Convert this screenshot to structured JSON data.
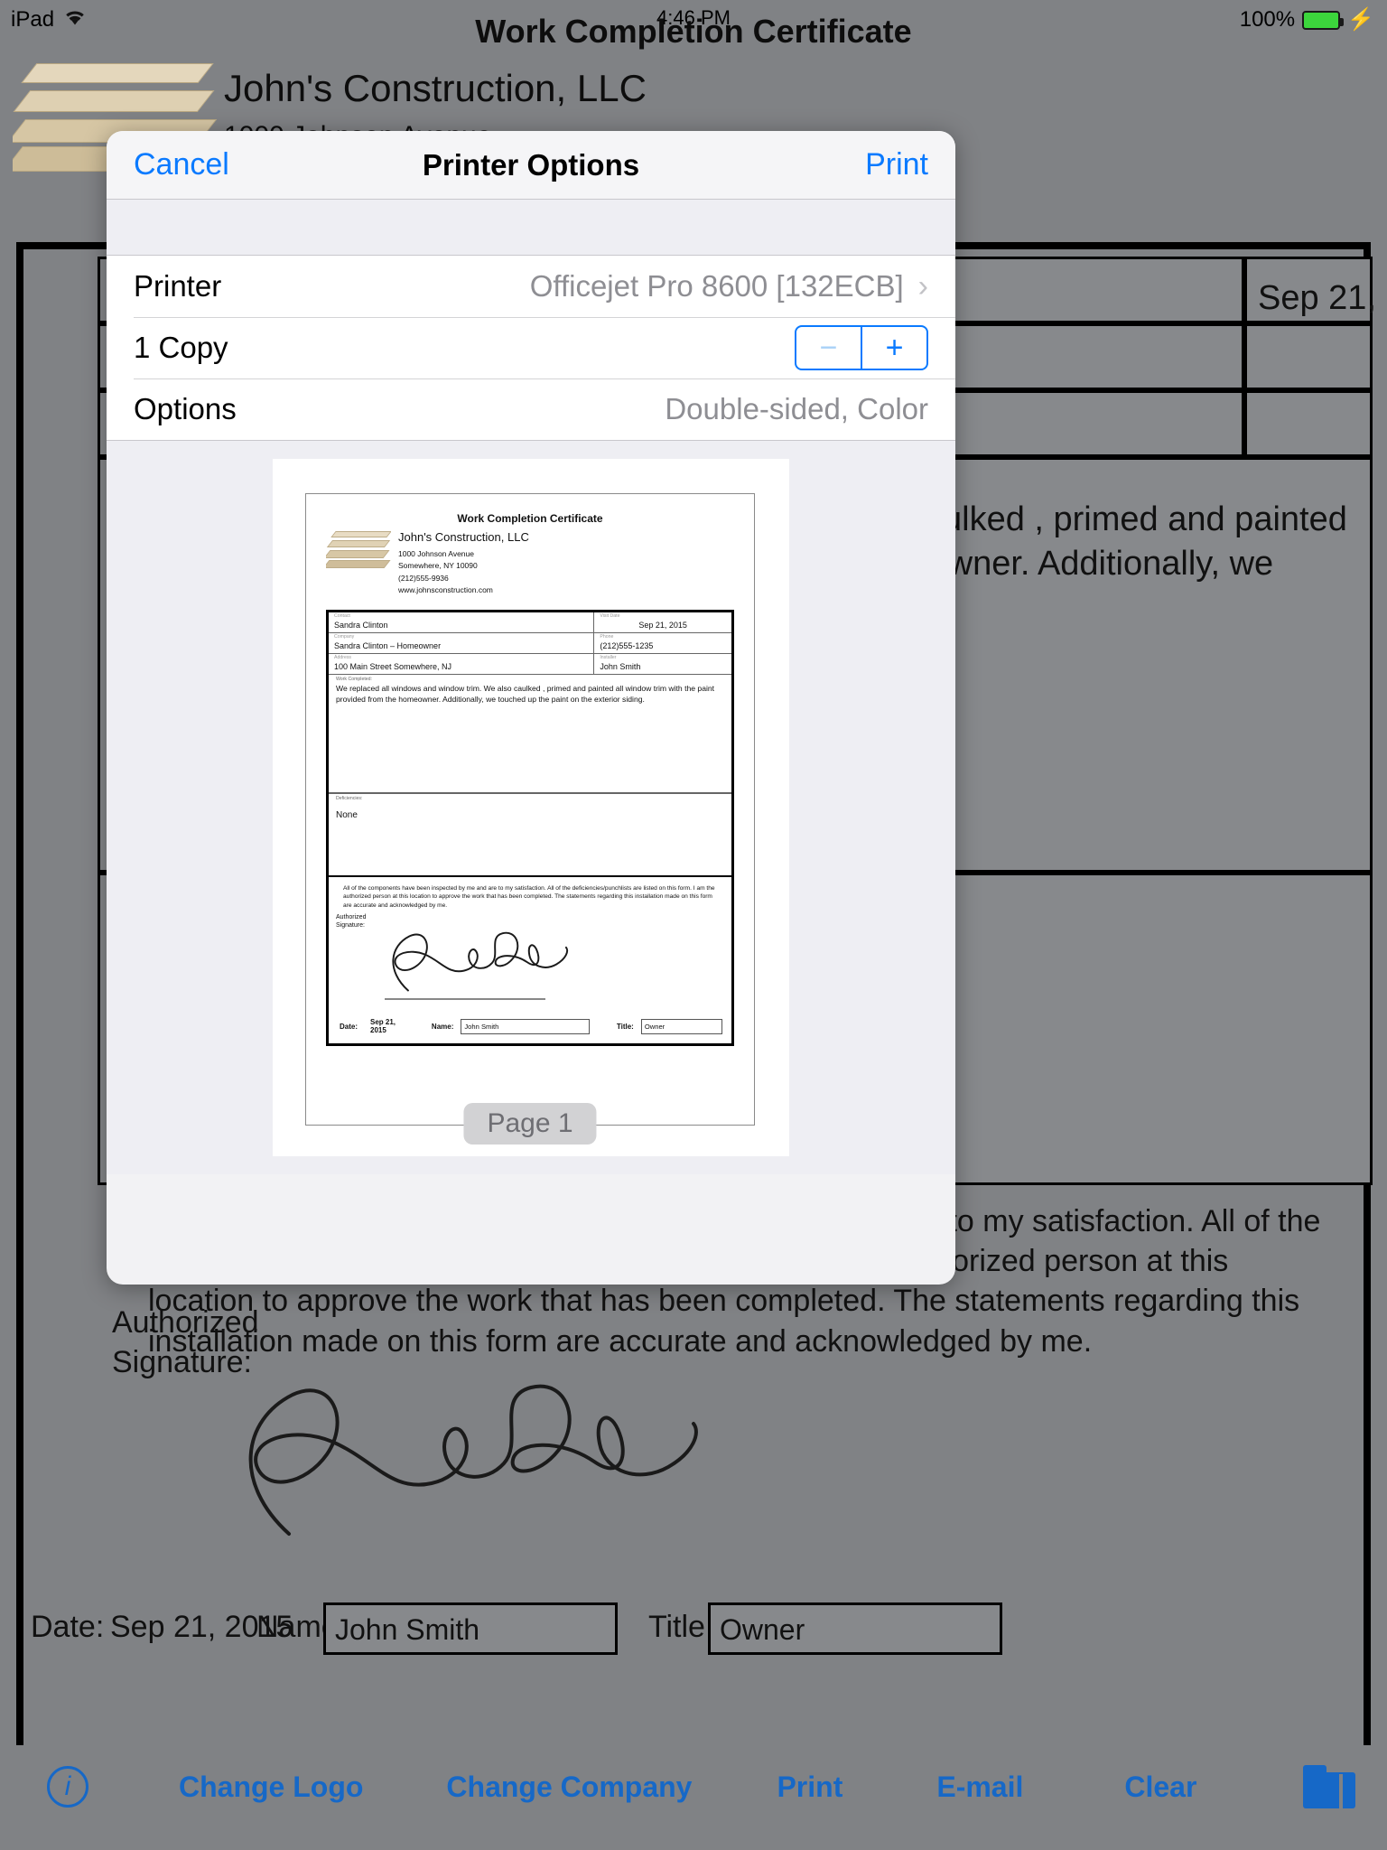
{
  "status_bar": {
    "device": "iPad",
    "wifi_icon": "wifi-icon",
    "time": "4:46 PM",
    "battery_percent": "100%",
    "charging_icon": "lightning-bolt-icon"
  },
  "app": {
    "title": "Work Completion Certificate",
    "company_name": "John's Construction, LLC",
    "address_line1": "1000 Johnson Avenue",
    "address_line2": "Somewhere, NY 10090"
  },
  "form": {
    "contact_label": "Contact",
    "contact_value": "Sandra Clinton",
    "company_label": "Company",
    "company_value": "Sandra Clinton – Homeowner",
    "address_label": "Address",
    "address_value": "100 Main Street Somewhere, NJ",
    "visit_date_value": "Sep 21, 2015",
    "work_completed_label": "Work Completed:",
    "work_completed_value": "We replaced all windows and window trim. We also caulked , primed and painted all window trim with the paint provided from the homeowner. Additionally, we touched up the paint on the exterior siding.",
    "deficiencies_label": "Deficiencies:",
    "deficiencies_value": "None",
    "legal_text": "All of the components have been inspected by me and are to my satisfaction. All of the deficiencies/punchlists are listed on this form. I am the authorized person at this location to approve the work that has been completed. The statements regarding this installation made on this form are accurate and acknowledged by me.",
    "signature_label": "Authorized\nSignature:",
    "date_label": "Date:",
    "date_value": "Sep 21, 2015",
    "name_label": "Name:",
    "name_value": "John Smith",
    "title_label": "Title:",
    "title_value": "Owner"
  },
  "toolbar": {
    "info_icon": "info-icon",
    "change_logo": "Change Logo",
    "change_company": "Change Company",
    "print": "Print",
    "email": "E-mail",
    "clear": "Clear",
    "folder_icon": "folder-icon"
  },
  "modal": {
    "cancel_label": "Cancel",
    "title": "Printer Options",
    "print_label": "Print",
    "rows": {
      "printer_label": "Printer",
      "printer_value": "Officejet Pro 8600 [132ECB]",
      "printer_chevron": "chevron-right-icon",
      "copies_label": "1 Copy",
      "minus_label": "−",
      "plus_label": "+",
      "options_label": "Options",
      "options_value": "Double-sided, Color"
    },
    "preview": {
      "page_badge": "Page 1",
      "doc": {
        "title": "Work Completion Certificate",
        "company": "John's Construction, LLC",
        "addr1": "1000 Johnson Avenue",
        "addr2": "Somewhere, NY 10090",
        "phone": "(212)555-9936",
        "web": "www.johnsconstruction.com",
        "contact_mini": "Contact",
        "contact": "Sandra Clinton",
        "visit_mini": "Visit Date",
        "visit": "Sep 21, 2015",
        "company_mini": "Company",
        "company_val": "Sandra Clinton – Homeowner",
        "phone_mini": "Phone",
        "phone_val": "(212)555-1235",
        "address_mini": "Address",
        "address_val": "100 Main Street Somewhere, NJ",
        "installer_mini": "Installer",
        "installer_val": "John Smith",
        "work_mini": "Work Completed:",
        "work_val": "We replaced all windows and window trim. We also caulked , primed and painted all window trim with the paint provided from the homeowner. Additionally, we touched up the paint on the exterior siding.",
        "def_mini": "Deficiencies:",
        "def_val": "None",
        "legal": "All of the components have been inspected by me and are to my satisfaction. All of the deficiencies/punchlists are listed on this form. I am the authorized person at this location to approve the work that has been completed. The statements regarding this installation made on this form are accurate and acknowledged by me.",
        "sig_label_1": "Authorized",
        "sig_label_2": "Signature:",
        "date_label": "Date:",
        "date_val": "Sep 21, 2015",
        "name_label": "Name:",
        "name_val": "John Smith",
        "title_label": "Title:",
        "title_val": "Owner"
      }
    }
  },
  "colors": {
    "accent_blue": "#0a7aff",
    "toolbar_blue": "#1668c7",
    "dim_gray": "#808285",
    "battery_green": "#3cd63c"
  }
}
